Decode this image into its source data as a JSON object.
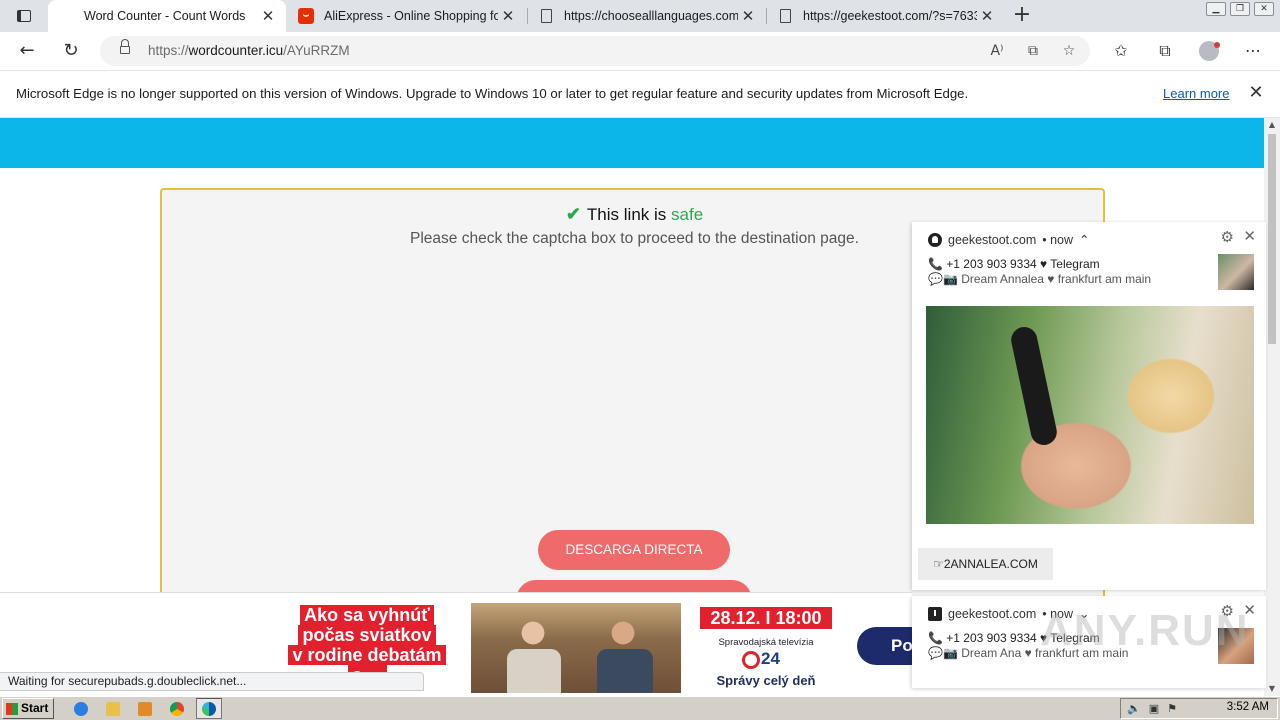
{
  "tabs": [
    {
      "title": "Word Counter - Count Words",
      "icon": "edge-page-icon",
      "active": true
    },
    {
      "title": "AliExpress - Online Shopping for",
      "icon": "aliexpress-icon",
      "active": false
    },
    {
      "title": "https://choosealllanguages.com/",
      "icon": "page-icon",
      "active": false
    },
    {
      "title": "https://geekestoot.com/?s=7633",
      "icon": "page-icon",
      "active": false
    }
  ],
  "toolbar": {
    "url_prefix": "https://",
    "url_host": "wordcounter.icu",
    "url_path": "/AYuRRZM"
  },
  "infobar": {
    "message": "Microsoft Edge is no longer supported on this version of Windows. Upgrade to Windows 10 or later to get regular feature and security updates from Microsoft Edge.",
    "learn_more": "Learn more"
  },
  "page": {
    "safe_prefix": "This link is",
    "safe_word": "safe",
    "captcha_text": "Please check the captcha box to proceed to the destination page.",
    "download_button": "DESCARGA DIRECTA",
    "header_color": "#0cb6e9",
    "button_color": "#ef6a6a"
  },
  "notifications": [
    {
      "site": "geekestoot.com",
      "time": "• now",
      "caret": "⌃",
      "line1": "📞 +1 203 903 9334 ♥ Telegram",
      "line2": "💬📷 Dream Annalea ♥ frankfurt am main",
      "cta": "☞2ANNALEA.COM"
    },
    {
      "site": "geekestoot.com",
      "time": "• now",
      "caret": "⌄",
      "line1": "📞 +1 203 903 9334 ♥ Telegram",
      "line2": "💬📷 Dream Ana ♥ frankfurt am main"
    }
  ],
  "ad": {
    "headline_lines": [
      "Ako sa vyhnúť",
      "počas sviatkov",
      "v rodine debatám",
      "o ..."
    ],
    "date": "28.12. I 18:00",
    "tv_label": "Spravodajská televízia",
    "logo_number": "24",
    "slogan": "Správy celý deň",
    "button_partial": "Po"
  },
  "status": "Waiting for securepubads.g.doubleclick.net...",
  "watermark": "ANY.RUN",
  "taskbar": {
    "start_label": "Start",
    "clock": "3:52 AM"
  }
}
